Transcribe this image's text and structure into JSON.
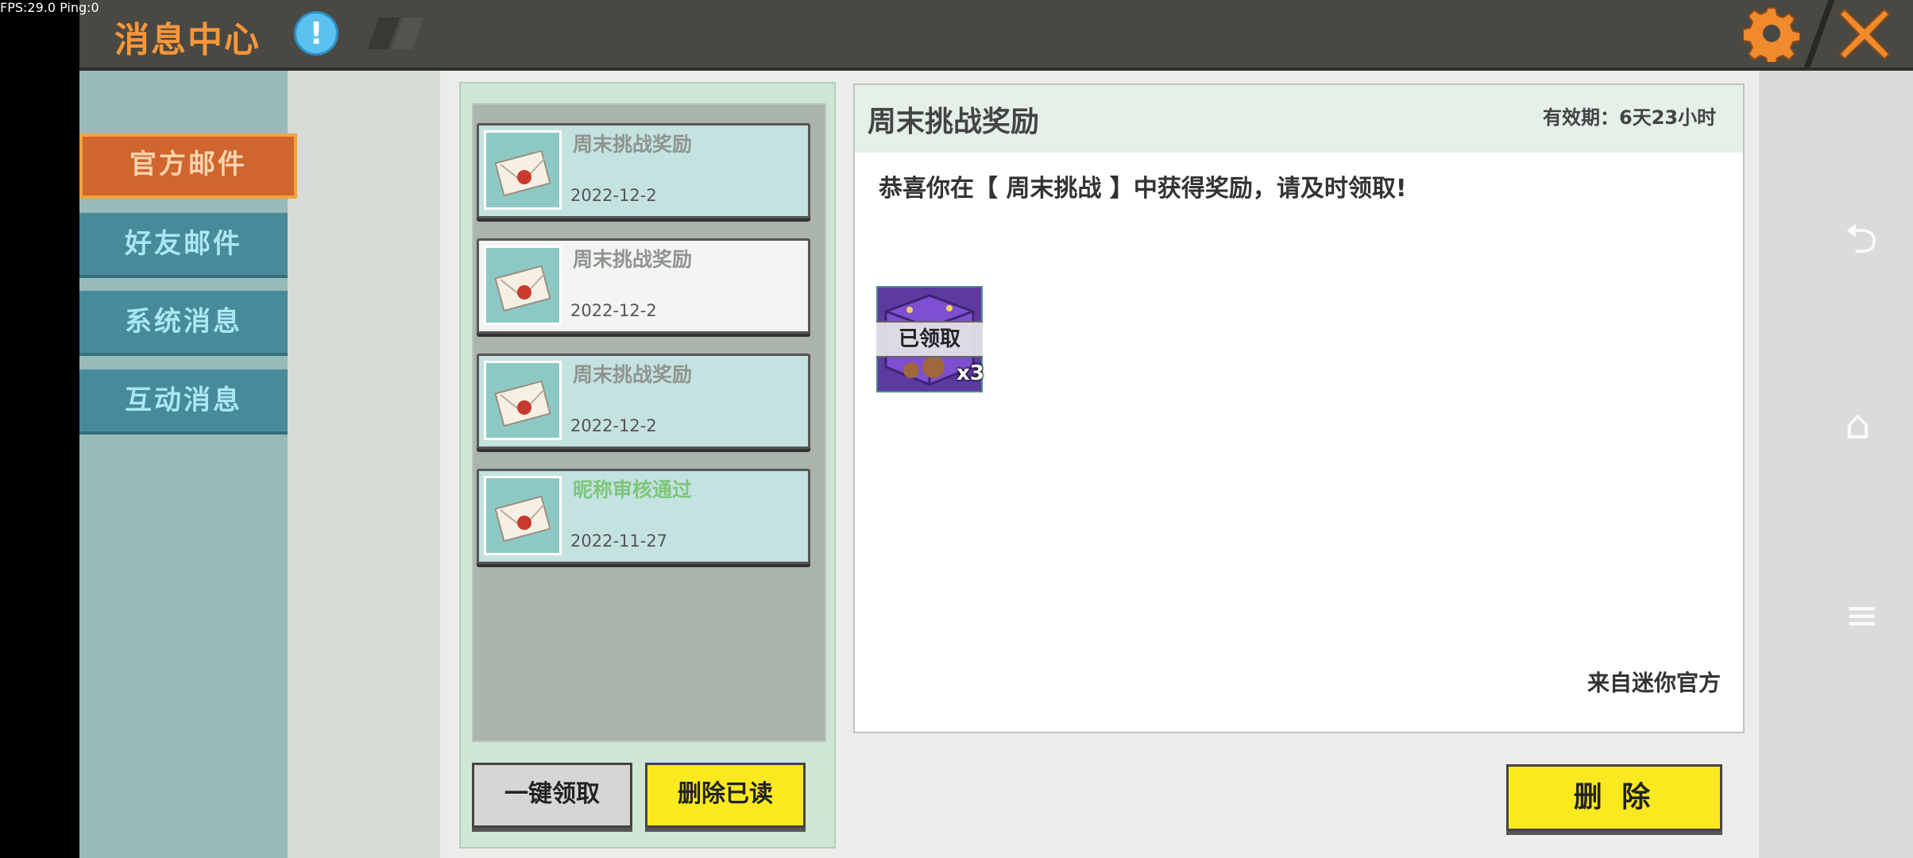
{
  "status": {
    "fps": "FPS:29.0  Ping:0"
  },
  "header": {
    "title": "消息中心",
    "info_glyph": "!"
  },
  "sidebar": {
    "tabs": [
      {
        "label": "官方邮件",
        "active": true
      },
      {
        "label": "好友邮件",
        "active": false
      },
      {
        "label": "系统消息",
        "active": false
      },
      {
        "label": "互动消息",
        "active": false
      }
    ]
  },
  "mail_list": [
    {
      "subject": "周末挑战奖励",
      "date": "2022-12-2",
      "selected": false
    },
    {
      "subject": "周末挑战奖励",
      "date": "2022-12-2",
      "selected": true
    },
    {
      "subject": "周末挑战奖励",
      "date": "2022-12-2",
      "selected": false
    },
    {
      "subject": "昵称审核通过",
      "date": "2022-11-27",
      "selected": false
    }
  ],
  "list_actions": {
    "claim_all": "一键领取",
    "delete_read": "删除已读"
  },
  "detail": {
    "title": "周末挑战奖励",
    "validity": "有效期：6天23小时",
    "body": "恭喜你在【 周末挑战 】中获得奖励，请及时领取!",
    "reward": {
      "status": "已领取",
      "quantity": "x3"
    },
    "sender": "来自迷你官方",
    "delete_label": "删 除"
  },
  "colors": {
    "accent": "#f7963a",
    "tab_active": "#d0652e",
    "tab": "#478b9b",
    "button_yellow": "#fbe91f",
    "subject_green": "#7cc77a"
  }
}
